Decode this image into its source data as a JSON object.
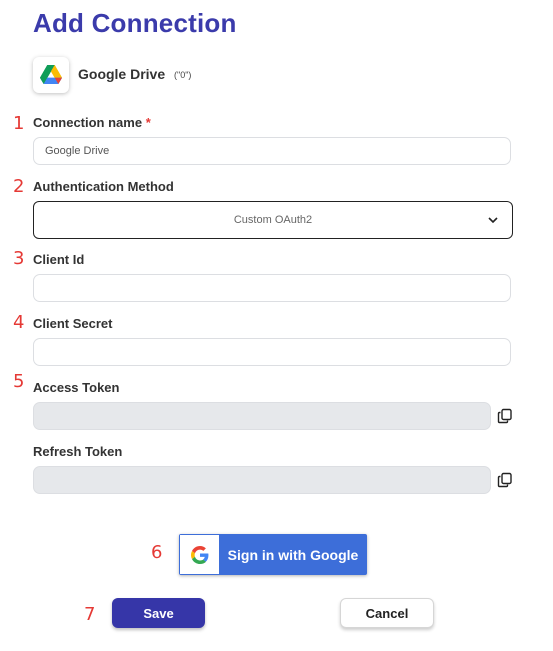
{
  "page": {
    "title": "Add Connection"
  },
  "app": {
    "name": "Google Drive",
    "badge": "(\"0\")",
    "icon": "google-drive-icon"
  },
  "steps": [
    "1",
    "2",
    "3",
    "4",
    "5",
    "6",
    "7"
  ],
  "fields": {
    "connection_name": {
      "label": "Connection name",
      "required_mark": "*",
      "value": "Google Drive"
    },
    "auth_method": {
      "label": "Authentication Method",
      "value": "Custom OAuth2"
    },
    "client_id": {
      "label": "Client Id",
      "value": ""
    },
    "client_secret": {
      "label": "Client Secret",
      "value": ""
    },
    "access_token": {
      "label": "Access Token",
      "value": ""
    },
    "refresh_token": {
      "label": "Refresh Token",
      "value": ""
    }
  },
  "buttons": {
    "google_signin": "Sign in with Google",
    "save": "Save",
    "cancel": "Cancel"
  },
  "colors": {
    "title": "#3b3bab",
    "step_numbers": "#e53935",
    "save_button": "#3636a8",
    "google_button": "#3d6ed9"
  }
}
